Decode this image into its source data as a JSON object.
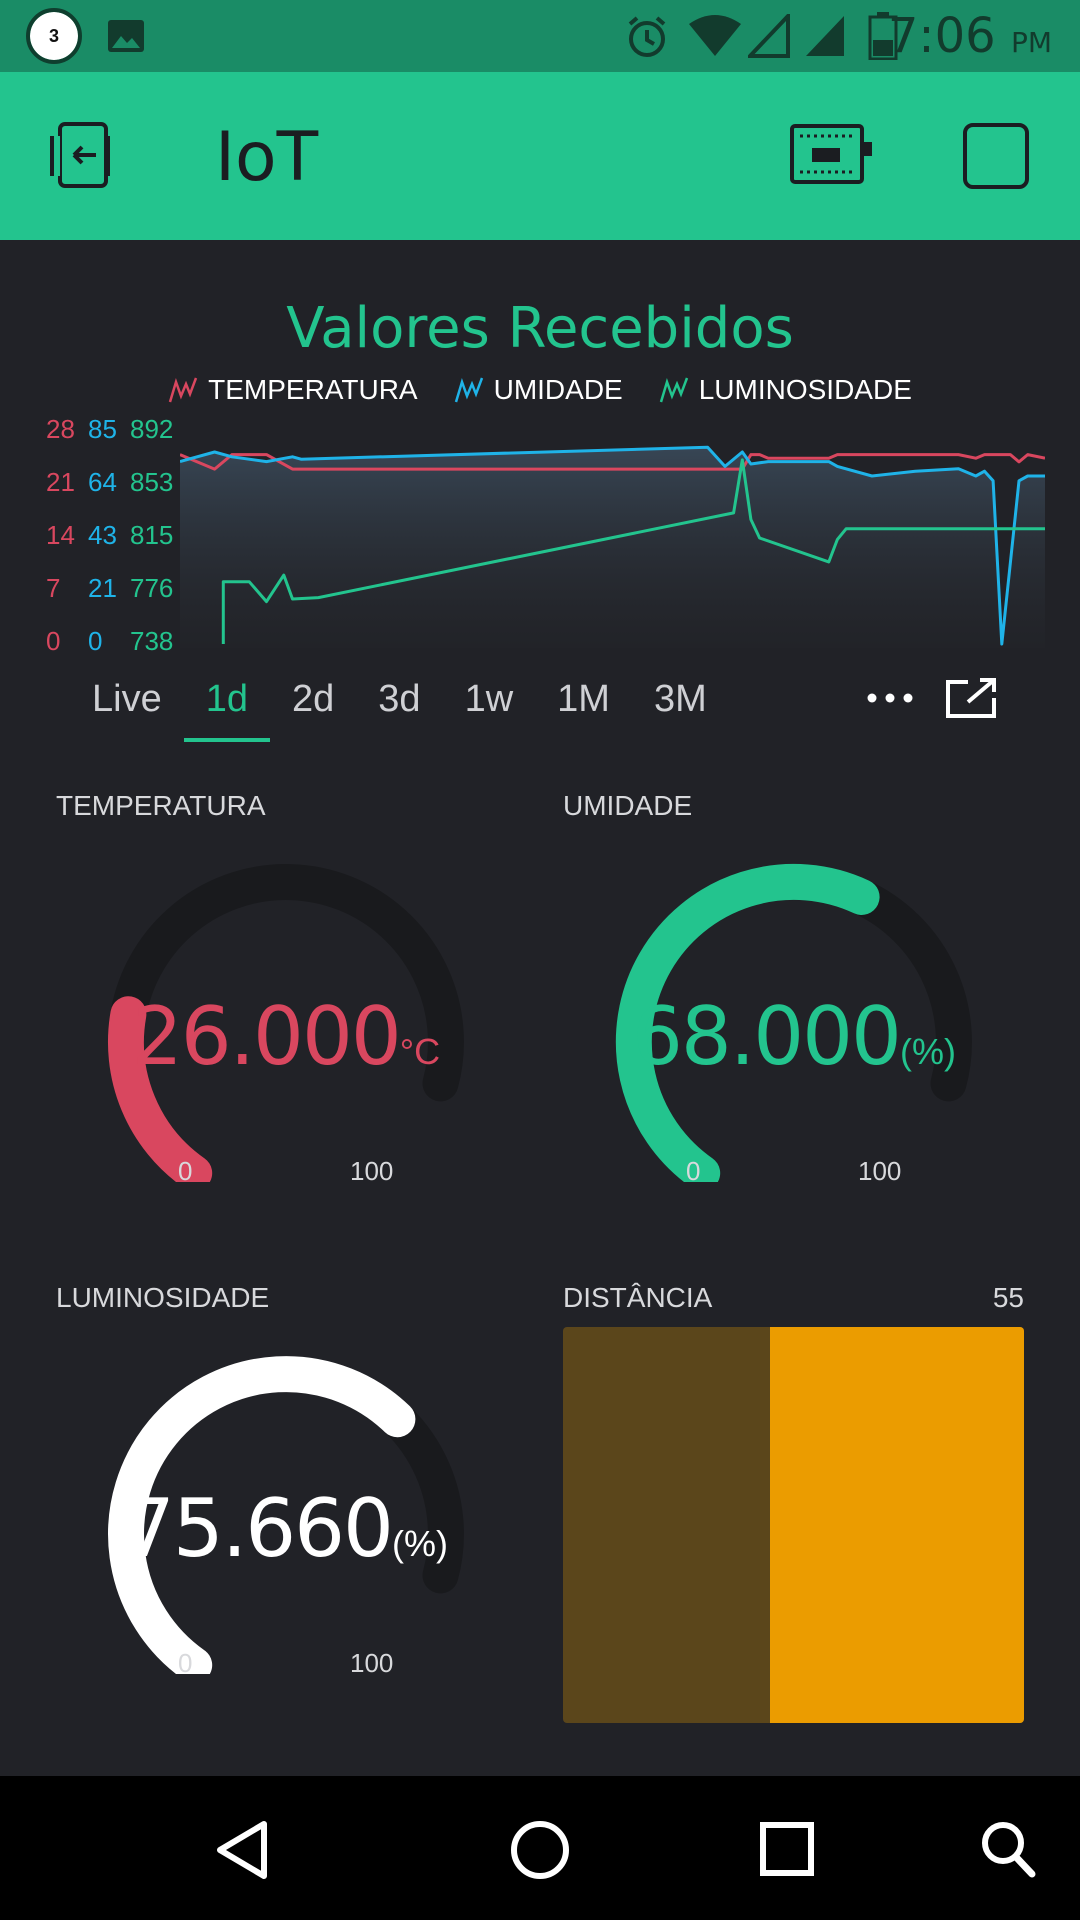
{
  "status_bar": {
    "notification_count": "3",
    "time": "7:06",
    "ampm": "PM"
  },
  "app_bar": {
    "title": "IoT"
  },
  "chart": {
    "title": "Valores Recebidos",
    "legend": [
      {
        "label": "TEMPERATURA",
        "color": "#d9475f"
      },
      {
        "label": "UMIDADE",
        "color": "#1fb3e8"
      },
      {
        "label": "LUMINOSIDADE",
        "color": "#23c48e"
      }
    ],
    "period_tabs": [
      "Live",
      "1d",
      "2d",
      "3d",
      "1w",
      "1M",
      "3M"
    ],
    "active_tab": "1d",
    "more_icon": "more-horizontal-icon",
    "export_icon": "open-external-icon"
  },
  "chart_data": {
    "type": "line",
    "y_axes": {
      "temperatura": [
        "28",
        "21",
        "14",
        "7",
        "0"
      ],
      "umidade": [
        "85",
        "64",
        "43",
        "21",
        "0"
      ],
      "luminosidade": [
        "892",
        "853",
        "815",
        "776",
        "738"
      ]
    },
    "series": [
      {
        "name": "TEMPERATURA",
        "axis": "temperatura",
        "ylim": [
          0,
          28
        ],
        "x": [
          0,
          0.04,
          0.06,
          0.1,
          0.13,
          0.14,
          0.65,
          0.66,
          0.67,
          0.68,
          0.75,
          0.76,
          0.9,
          0.92,
          0.93,
          0.94,
          0.96,
          0.97,
          0.98,
          1.0
        ],
        "y": [
          26,
          24,
          26,
          26,
          24,
          24,
          24,
          26,
          26,
          25.5,
          25.5,
          26,
          26,
          25.5,
          26,
          26,
          26,
          25,
          26,
          25.5
        ]
      },
      {
        "name": "UMIDADE",
        "axis": "umidade",
        "ylim": [
          0,
          85
        ],
        "x": [
          0,
          0.04,
          0.06,
          0.1,
          0.13,
          0.14,
          0.61,
          0.63,
          0.65,
          0.66,
          0.68,
          0.75,
          0.76,
          0.8,
          0.85,
          0.9,
          0.92,
          0.93,
          0.94,
          0.95,
          0.97,
          0.98,
          1.0
        ],
        "y": [
          76,
          80,
          78,
          76,
          78,
          77,
          82,
          74,
          80,
          75,
          76,
          76,
          74,
          70,
          72,
          73,
          70,
          72,
          68,
          0,
          68,
          70,
          70
        ]
      },
      {
        "name": "LUMINOSIDADE",
        "axis": "luminosidade",
        "ylim": [
          738,
          892
        ],
        "x": [
          0.05,
          0.05,
          0.08,
          0.1,
          0.12,
          0.13,
          0.16,
          0.64,
          0.65,
          0.66,
          0.67,
          0.75,
          0.76,
          0.77,
          0.94,
          0.95,
          1.0
        ],
        "y": [
          738,
          785,
          785,
          770,
          790,
          772,
          773,
          837,
          877,
          832,
          818,
          800,
          817,
          825,
          825,
          825,
          825
        ]
      }
    ]
  },
  "gauges": [
    {
      "label": "TEMPERATURA",
      "value": "26.000",
      "unit": "°C",
      "min": "0",
      "max": "100",
      "fraction": 0.26,
      "color": "#d9475f"
    },
    {
      "label": "UMIDADE",
      "value": "68.000",
      "unit": "(%)",
      "min": "0",
      "max": "100",
      "fraction": 0.68,
      "color": "#23c48e"
    },
    {
      "label": "LUMINOSIDADE",
      "value": "75.660",
      "unit": "(%)",
      "min": "0",
      "max": "100",
      "fraction": 0.7566,
      "color": "#ffffff"
    }
  ],
  "level": {
    "label": "DISTÂNCIA",
    "value": "55",
    "fill_fraction": 0.55,
    "fill_color": "#eb9c00",
    "track_color": "#5b461b"
  },
  "nav": {
    "back_icon": "back-triangle-icon",
    "home_icon": "home-circle-icon",
    "recents_icon": "recents-square-icon",
    "search_icon": "search-icon"
  }
}
